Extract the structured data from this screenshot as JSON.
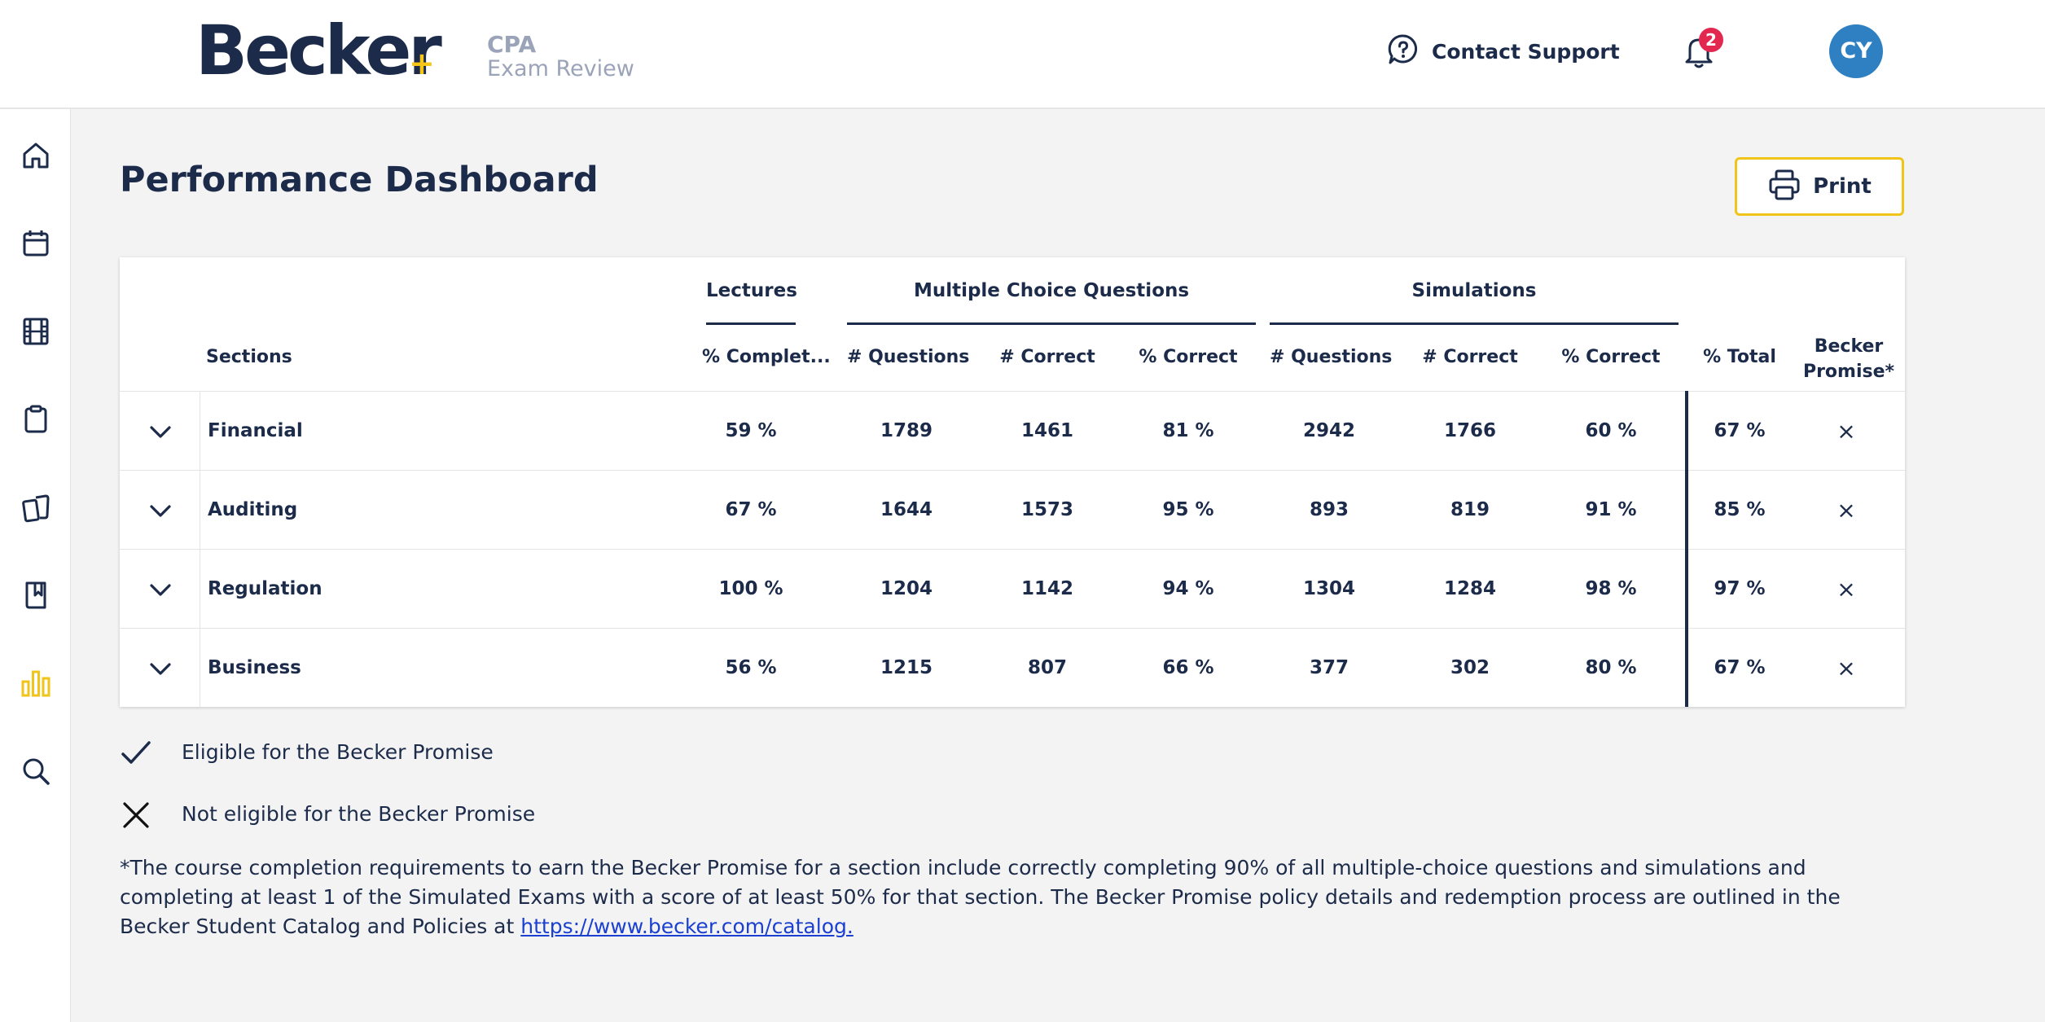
{
  "brand": {
    "name": "Becker",
    "plus": "+",
    "product_line1": "CPA",
    "product_line2": "Exam Review"
  },
  "header": {
    "contact_support": "Contact Support",
    "notification_count": "2",
    "avatar_initials": "CY"
  },
  "sidebar": {
    "items": [
      {
        "icon": "home-icon"
      },
      {
        "icon": "calendar-icon"
      },
      {
        "icon": "film-icon"
      },
      {
        "icon": "clipboard-icon"
      },
      {
        "icon": "flashcards-icon"
      },
      {
        "icon": "bookmark-book-icon"
      },
      {
        "icon": "bar-chart-icon",
        "active": true
      },
      {
        "icon": "search-icon"
      }
    ],
    "active_color": "#f0c419"
  },
  "page": {
    "title": "Performance Dashboard",
    "print_label": "Print"
  },
  "table": {
    "group_headers": {
      "lectures": "Lectures",
      "mcq": "Multiple Choice Questions",
      "sims": "Simulations"
    },
    "columns": {
      "sections": "Sections",
      "lect_pct": "% Complet...",
      "mcq_q": "# Questions",
      "mcq_c": "# Correct",
      "mcq_pct": "% Correct",
      "sim_q": "# Questions",
      "sim_c": "# Correct",
      "sim_pct": "% Correct",
      "total": "% Total",
      "promise_l1": "Becker",
      "promise_l2": "Promise*"
    },
    "rows": [
      {
        "section": "Financial",
        "lect_pct": "59 %",
        "mcq_q": "1789",
        "mcq_c": "1461",
        "mcq_pct": "81 %",
        "sim_q": "2942",
        "sim_c": "1766",
        "sim_pct": "60 %",
        "total": "67 %",
        "promise": "×"
      },
      {
        "section": "Auditing",
        "lect_pct": "67 %",
        "mcq_q": "1644",
        "mcq_c": "1573",
        "mcq_pct": "95 %",
        "sim_q": "893",
        "sim_c": "819",
        "sim_pct": "91 %",
        "total": "85 %",
        "promise": "×"
      },
      {
        "section": "Regulation",
        "lect_pct": "100 %",
        "mcq_q": "1204",
        "mcq_c": "1142",
        "mcq_pct": "94 %",
        "sim_q": "1304",
        "sim_c": "1284",
        "sim_pct": "98 %",
        "total": "97 %",
        "promise": "×"
      },
      {
        "section": "Business",
        "lect_pct": "56 %",
        "mcq_q": "1215",
        "mcq_c": "807",
        "mcq_pct": "66 %",
        "sim_q": "377",
        "sim_c": "302",
        "sim_pct": "80 %",
        "total": "67 %",
        "promise": "×"
      }
    ]
  },
  "legend": {
    "eligible": "Eligible for the Becker Promise",
    "not_eligible": "Not eligible for the Becker Promise"
  },
  "footnote": {
    "text": "*The course completion requirements to earn the Becker Promise for a section include correctly completing 90% of all multiple-choice questions and simulations and completing at least 1 of the Simulated Exams with a score of at least 50% for that section. The Becker Promise policy details and redemption process are outlined in the Becker Student Catalog and Policies at ",
    "link": "https://www.becker.com/catalog."
  }
}
